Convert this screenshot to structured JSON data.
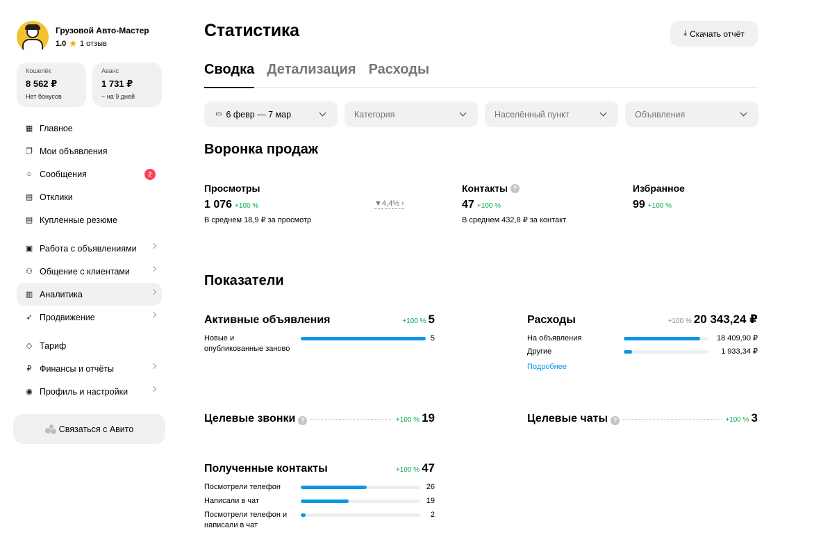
{
  "profile": {
    "name": "Грузовой Авто-Мастер",
    "rating": "1.0",
    "reviews": "1 отзыв"
  },
  "wallet": {
    "title": "Кошелёк",
    "value": "8 562 ₽",
    "sub": "Нет бонусов"
  },
  "advance": {
    "title": "Аванс",
    "value": "1 731 ₽",
    "sub": "~ на 9 дней"
  },
  "nav": [
    {
      "label": "Главное"
    },
    {
      "label": "Мои объявления"
    },
    {
      "label": "Сообщения",
      "badge": "2"
    },
    {
      "label": "Отклики"
    },
    {
      "label": "Купленные резюме"
    },
    {
      "label": "Работа с объявлениями"
    },
    {
      "label": "Общение с клиентами"
    },
    {
      "label": "Аналитика"
    },
    {
      "label": "Продвижение"
    },
    {
      "label": "Тариф"
    },
    {
      "label": "Финансы и отчёты"
    },
    {
      "label": "Профиль и настройки"
    }
  ],
  "contact_button": "Связаться с Авито",
  "page_title": "Статистика",
  "download_button": "Скачать отчёт",
  "tabs": [
    "Сводка",
    "Детализация",
    "Расходы"
  ],
  "filters": {
    "date": "6 февр — 7 мар",
    "category": "Категория",
    "city": "Населённый пункт",
    "ads": "Объявления"
  },
  "funnel": {
    "title": "Воронка продаж",
    "views": {
      "label": "Просмотры",
      "value": "1 076",
      "pct": "+100 %",
      "sub": "В среднем 18,9 ₽ за просмотр"
    },
    "conversion": "4,4%",
    "contacts": {
      "label": "Контакты",
      "value": "47",
      "pct": "+100 %",
      "sub": "В среднем 432,8 ₽ за контакт"
    },
    "favorites": {
      "label": "Избранное",
      "value": "99",
      "pct": "+100 %"
    }
  },
  "indicators": {
    "title": "Показатели",
    "active": {
      "title": "Активные объявления",
      "pct": "+100 %",
      "value": "5",
      "rows": [
        {
          "label": "Новые и опубликованные заново",
          "value": "5",
          "share": 1.0
        }
      ]
    },
    "expenses": {
      "title": "Расходы",
      "pct": "+100 %",
      "value": "20 343,24 ₽",
      "more": "Подробнее",
      "rows": [
        {
          "label": "На объявления",
          "value": "18 409,90 ₽",
          "share": 0.905
        },
        {
          "label": "Другие",
          "value": "1 933,34 ₽",
          "share": 0.095
        }
      ]
    },
    "calls": {
      "title": "Целевые звонки",
      "pct": "+100 %",
      "value": "19"
    },
    "chats": {
      "title": "Целевые чаты",
      "pct": "+100 %",
      "value": "3"
    },
    "received": {
      "title": "Полученные контакты",
      "pct": "+100 %",
      "value": "47",
      "rows": [
        {
          "label": "Посмотрели телефон",
          "value": "26",
          "share": 0.553
        },
        {
          "label": "Написали в чат",
          "value": "19",
          "share": 0.404
        },
        {
          "label": "Посмотрели телефон и написали в чат",
          "value": "2",
          "share": 0.043
        }
      ]
    }
  }
}
